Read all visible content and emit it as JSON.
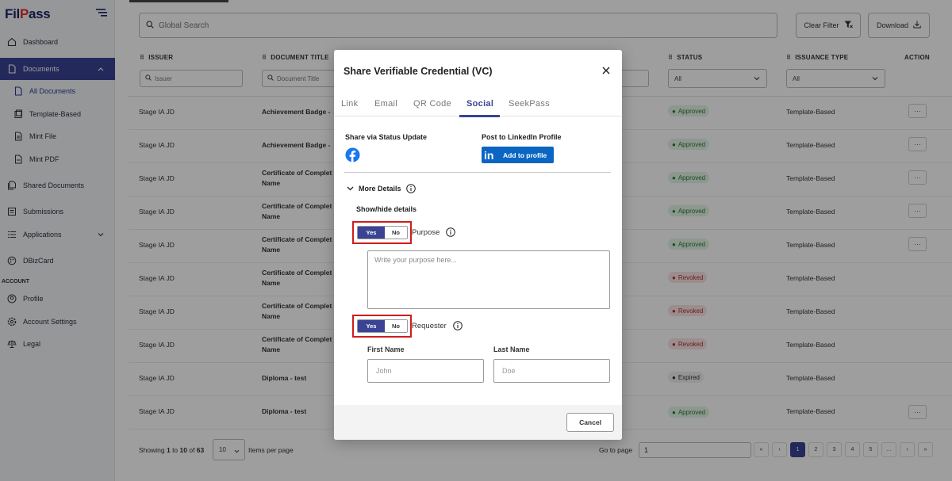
{
  "app": {
    "logo_main": "Fil",
    "logo_accent": "P",
    "logo_rest": "ass"
  },
  "sidebar": {
    "items": [
      {
        "label": "Dashboard"
      },
      {
        "label": "Documents"
      },
      {
        "label": "All Documents"
      },
      {
        "label": "Template-Based"
      },
      {
        "label": "Mint File"
      },
      {
        "label": "Mint PDF"
      },
      {
        "label": "Shared Documents"
      },
      {
        "label": "Submissions"
      },
      {
        "label": "Applications"
      },
      {
        "label": "DBizCard"
      },
      {
        "label": "Profile"
      },
      {
        "label": "Account Settings"
      },
      {
        "label": "Legal"
      }
    ],
    "section_account": "ACCOUNT"
  },
  "toolbar": {
    "search_placeholder": "Global Search",
    "clear_filter": "Clear Filter",
    "download": "Download"
  },
  "table": {
    "columns": {
      "issuer": "ISSUER",
      "document_title": "DOCUMENT TITLE",
      "status": "STATUS",
      "issuance_type": "ISSUANCE TYPE",
      "action": "ACTION"
    },
    "filters": {
      "issuer_placeholder": "Issuer",
      "title_placeholder": "Document Title",
      "status_value": "All",
      "issuance_value": "All"
    },
    "rows": [
      {
        "issuer": "Stage IA JD",
        "title": "Achievement Badge - ",
        "title2": "",
        "status": "Approved",
        "issuance": "Template-Based"
      },
      {
        "issuer": "Stage IA JD",
        "title": "Achievement Badge - ",
        "title2": "",
        "status": "Approved",
        "issuance": "Template-Based"
      },
      {
        "issuer": "Stage IA JD",
        "title": "Certificate of Complet",
        "title2": "Name",
        "status": "Approved",
        "issuance": "Template-Based"
      },
      {
        "issuer": "Stage IA JD",
        "title": "Certificate of Complet",
        "title2": "Name",
        "status": "Approved",
        "issuance": "Template-Based"
      },
      {
        "issuer": "Stage IA JD",
        "title": "Certificate of Complet",
        "title2": "Name",
        "status": "Approved",
        "issuance": "Template-Based"
      },
      {
        "issuer": "Stage IA JD",
        "title": "Certificate of Complet",
        "title2": "Name",
        "status": "Revoked",
        "issuance": "Template-Based"
      },
      {
        "issuer": "Stage IA JD",
        "title": "Certificate of Complet",
        "title2": "Name",
        "status": "Revoked",
        "issuance": "Template-Based"
      },
      {
        "issuer": "Stage IA JD",
        "title": "Certificate of Complet",
        "title2": "Name",
        "status": "Revoked",
        "issuance": "Template-Based"
      },
      {
        "issuer": "Stage IA JD",
        "title": "Diploma - test",
        "title2": "",
        "status": "Expired",
        "issuance": "Template-Based"
      },
      {
        "issuer": "Stage IA JD",
        "title": "Diploma - test",
        "title2": "",
        "status": "Approved",
        "issuance": "Template-Based"
      }
    ],
    "action_label": "···"
  },
  "footer": {
    "showing_prefix": "Showing ",
    "from": "1",
    "to_word": " to ",
    "to": "10",
    "of_word": " of ",
    "total": "63",
    "per_page_value": "10",
    "items_per_page": "Items per page",
    "go_to_page": "Go to page",
    "go_to_value": "1",
    "pages": [
      "«",
      "‹",
      "1",
      "2",
      "3",
      "4",
      "5",
      "...",
      "›",
      "»"
    ]
  },
  "modal": {
    "title": "Share Verifiable Credential (VC)",
    "tabs": [
      "Link",
      "Email",
      "QR Code",
      "Social",
      "SeekPass"
    ],
    "share_status": "Share via Status Update",
    "post_linkedin": "Post to LinkedIn Profile",
    "linkedin_logo": "in",
    "add_to_profile": "Add to profile",
    "more_details": "More Details",
    "show_hide": "Show/hide details",
    "toggle_yes": "Yes",
    "toggle_no": "No",
    "purpose_label": "Purpose",
    "purpose_placeholder": "Write your purpose here...",
    "requester_label": "Requester",
    "first_name_label": "First Name",
    "first_name_placeholder": "John",
    "last_name_label": "Last Name",
    "last_name_placeholder": "Doe",
    "cancel": "Cancel"
  },
  "colors": {
    "primary": "#3a4394",
    "highlight": "#d11c1c",
    "linkedin": "#0a66c2",
    "facebook": "#1877f2"
  }
}
